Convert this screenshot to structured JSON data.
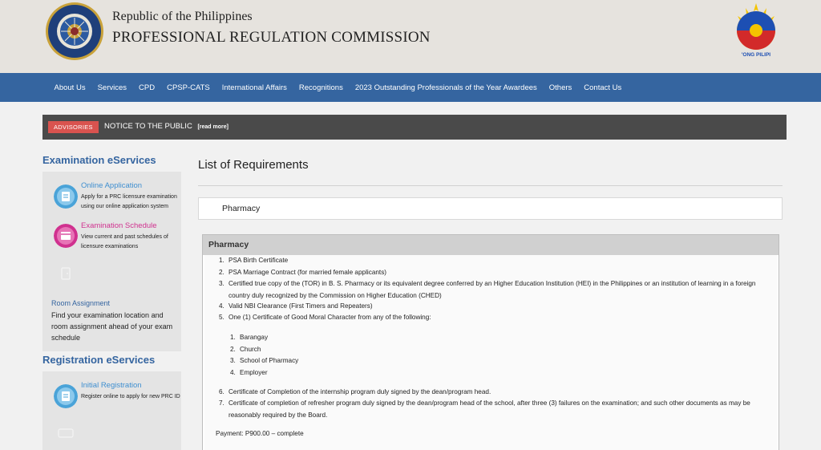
{
  "header": {
    "agency_line1": "Republic of the Philippines",
    "agency_line2": "PROFESSIONAL REGULATION COMMISSION",
    "seal_text_top": "PROFESSIONAL REGULATION COMMISSION",
    "seal_text_bottom": "REPUBLIC OF THE PHILIPPINES",
    "logo_text": "'ONG PILIPI"
  },
  "nav": {
    "items": [
      "About Us",
      "Services",
      "CPD",
      "CPSP-CATS",
      "International Affairs",
      "Recognitions",
      "2023 Outstanding Professionals of the Year Awardees",
      "Others",
      "Contact Us"
    ]
  },
  "advisory": {
    "badge": "ADVISORIES",
    "text": "NOTICE TO THE PUBLIC",
    "read_more": "[read more]"
  },
  "sidebar": {
    "exam_heading": "Examination eServices",
    "exam_items": [
      {
        "title": "Online Application",
        "desc": "Apply for a PRC licensure examination using our online application system",
        "color": "#4aa3d8"
      },
      {
        "title": "Examination Schedule",
        "desc": "View current and past schedules of licensure examinations",
        "color": "#d0318f"
      }
    ],
    "room": {
      "title": "Room Assignment",
      "desc": "Find your examination location and room assignment ahead of your exam schedule"
    },
    "reg_heading": "Registration eServices",
    "reg_items": [
      {
        "title": "Initial Registration",
        "desc": "Register online to apply for new PRC ID",
        "color": "#4aa3d8"
      }
    ]
  },
  "main": {
    "title": "List of Requirements",
    "program": "Pharmacy",
    "panel_title": "Pharmacy",
    "requirements": [
      "PSA Birth Certificate",
      "PSA Marriage Contract (for married female applicants)",
      "Certified true copy of the (TOR) in B. S. Pharmacy or its equivalent degree conferred by an Higher Education Institution (HEI) in the Philippines or an institution of learning in a foreign country duly recognized by the Commission on Higher Education (CHED)",
      "Valid NBI Clearance (First Timers and Repeaters)",
      "One (1) Certificate of Good Moral Character from any of the following:",
      "Certificate of Completion of the internship program duly signed by the dean/program head.",
      "Certificate of completion of refresher program duly signed by the dean/program head of the school, after three (3) failures on the examination; and such other documents as may be reasonably required by the Board."
    ],
    "moral_sources": [
      "Barangay",
      "Church",
      "School of Pharmacy",
      "Employer"
    ],
    "payment": "Payment: P900.00 – complete"
  },
  "colors": {
    "nav_bg": "#3565a0",
    "header_bg": "#e6e3de",
    "advisory_bg": "#4a4a4a",
    "badge_bg": "#d9534f",
    "accent_blue": "#3565a0",
    "accent_pink": "#d0318f"
  }
}
